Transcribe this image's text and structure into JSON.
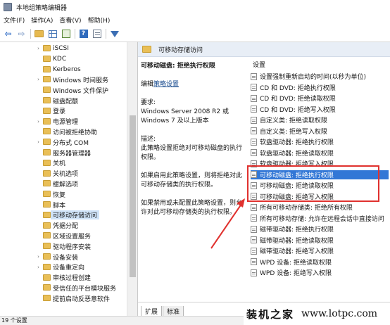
{
  "window": {
    "title": "本地组策略编辑器"
  },
  "menu": [
    "文件(F)",
    "操作(A)",
    "查看(V)",
    "帮助(H)"
  ],
  "toolbar": {
    "icons": [
      "back-arrow-icon",
      "forward-arrow-icon",
      "folder-up-icon",
      "show-hide-tree-icon",
      "export-list-icon",
      "help-icon",
      "properties-icon",
      "filter-icon"
    ],
    "back_glyph": "⇦",
    "forward_glyph": "⇨",
    "help_glyph": "?"
  },
  "tree": {
    "items": [
      {
        "label": "iSCSI",
        "expander": "›",
        "selected": false
      },
      {
        "label": "KDC",
        "expander": "",
        "selected": false
      },
      {
        "label": "Kerberos",
        "expander": "",
        "selected": false
      },
      {
        "label": "Windows 时间服务",
        "expander": "›",
        "selected": false
      },
      {
        "label": "Windows 文件保护",
        "expander": "",
        "selected": false
      },
      {
        "label": "磁盘配额",
        "expander": "",
        "selected": false
      },
      {
        "label": "登录",
        "expander": "",
        "selected": false
      },
      {
        "label": "电源管理",
        "expander": "›",
        "selected": false
      },
      {
        "label": "访问被拒绝协助",
        "expander": "",
        "selected": false
      },
      {
        "label": "分布式 COM",
        "expander": "›",
        "selected": false
      },
      {
        "label": "服务器管理器",
        "expander": "",
        "selected": false
      },
      {
        "label": "关机",
        "expander": "",
        "selected": false
      },
      {
        "label": "关机选项",
        "expander": "",
        "selected": false
      },
      {
        "label": "缓解选项",
        "expander": "",
        "selected": false
      },
      {
        "label": "恢复",
        "expander": "",
        "selected": false
      },
      {
        "label": "脚本",
        "expander": "",
        "selected": false
      },
      {
        "label": "可移动存储访问",
        "expander": "",
        "selected": true
      },
      {
        "label": "凭据分配",
        "expander": "",
        "selected": false
      },
      {
        "label": "区域设置服务",
        "expander": "",
        "selected": false
      },
      {
        "label": "驱动程序安装",
        "expander": "",
        "selected": false
      },
      {
        "label": "设备安装",
        "expander": "›",
        "selected": false
      },
      {
        "label": "设备重定向",
        "expander": "›",
        "selected": false
      },
      {
        "label": "审核过程创建",
        "expander": "",
        "selected": false
      },
      {
        "label": "受信任的平台模块服务",
        "expander": "",
        "selected": false
      },
      {
        "label": "提前启动反恶意软件",
        "expander": "",
        "selected": false
      }
    ]
  },
  "right": {
    "header_title": "可移动存储访问",
    "desc": {
      "title": "可移动磁盘: 拒绝执行权限",
      "edit_prefix": "编辑",
      "edit_link": "策略设置",
      "requirements_label": "要求:",
      "requirements_lines": [
        "Windows Server 2008 R2 或",
        "Windows 7 及以上版本"
      ],
      "description_label": "描述:",
      "description_lines": [
        "此策略设置拒绝对可移动磁盘的执行",
        "权限。"
      ],
      "enabled_lines": [
        "如果启用此策略设置，则将拒绝对此",
        "可移动存储类的执行权限。"
      ],
      "disabled_lines": [
        "如果禁用或未配置此策略设置，则允",
        "许对此可移动存储类的执行权限。"
      ]
    },
    "list_heading": "设置",
    "policies": [
      {
        "label": "设置强制重新启动的时间(以秒为单位)",
        "selected": false
      },
      {
        "label": "CD 和 DVD: 拒绝执行权限",
        "selected": false
      },
      {
        "label": "CD 和 DVD: 拒绝读取权限",
        "selected": false
      },
      {
        "label": "CD 和 DVD: 拒绝写入权限",
        "selected": false
      },
      {
        "label": "自定义类: 拒绝读取权限",
        "selected": false
      },
      {
        "label": "自定义类: 拒绝写入权限",
        "selected": false
      },
      {
        "label": "软盘驱动器: 拒绝执行权限",
        "selected": false
      },
      {
        "label": "软盘驱动器: 拒绝读取权限",
        "selected": false
      },
      {
        "label": "软盘驱动器: 拒绝写入权限",
        "selected": false
      },
      {
        "label": "可移动磁盘: 拒绝执行权限",
        "selected": true
      },
      {
        "label": "可移动磁盘: 拒绝读取权限",
        "selected": false
      },
      {
        "label": "可移动磁盘: 拒绝写入权限",
        "selected": false
      },
      {
        "label": "所有可移动存储类: 拒绝所有权限",
        "selected": false
      },
      {
        "label": "所有可移动存储: 允许在远程会话中直接访问",
        "selected": false
      },
      {
        "label": "磁带驱动器: 拒绝执行权限",
        "selected": false
      },
      {
        "label": "磁带驱动器: 拒绝读取权限",
        "selected": false
      },
      {
        "label": "磁带驱动器: 拒绝写入权限",
        "selected": false
      },
      {
        "label": "WPD 设备: 拒绝读取权限",
        "selected": false
      },
      {
        "label": "WPD 设备: 拒绝写入权限",
        "selected": false
      }
    ],
    "tabs": [
      "扩展",
      "标准"
    ],
    "active_tab": 0
  },
  "status": {
    "text": "19 个设置"
  },
  "watermark": {
    "cn": "装机之家",
    "en": "www.lotpc.com"
  },
  "colors": {
    "selection": "#3277d6",
    "annotation": "#e0312e",
    "header_bg": "#e8eef6",
    "link": "#1d4f91"
  }
}
